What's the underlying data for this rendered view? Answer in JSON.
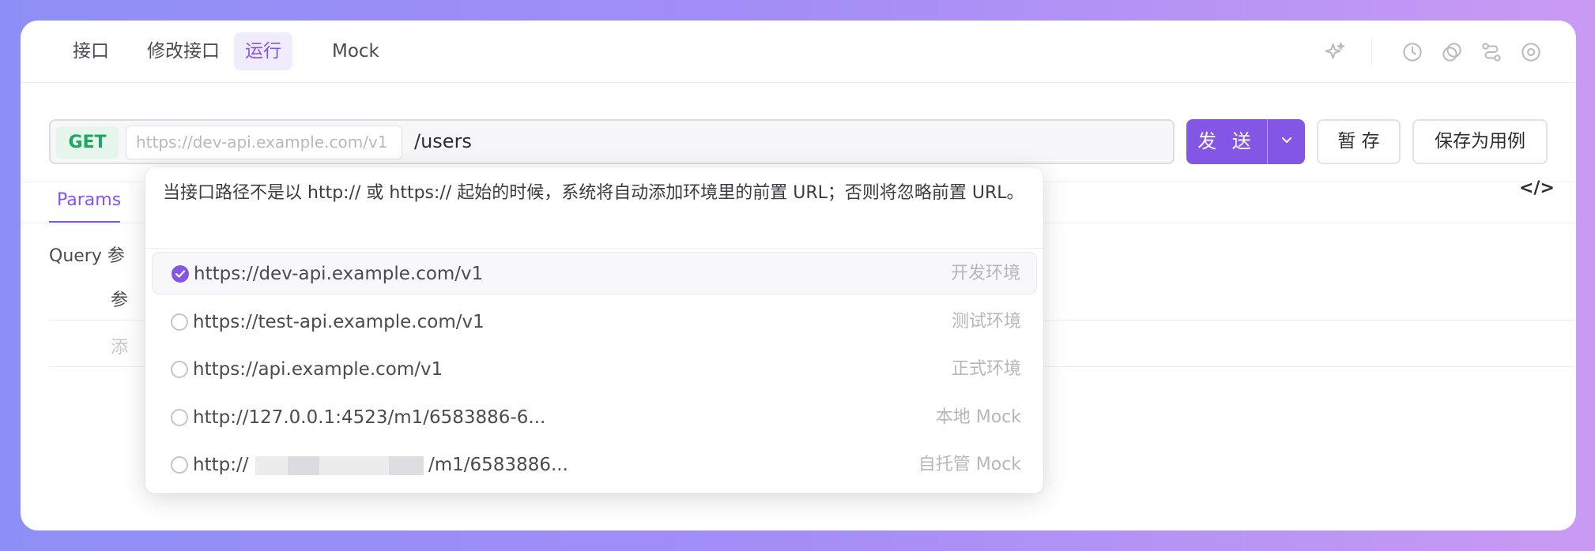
{
  "tabs": [
    {
      "label": "接口"
    },
    {
      "label": "修改接口"
    },
    {
      "label": "运行"
    },
    {
      "label": "Mock"
    }
  ],
  "toolbar_icons": [
    "sparkle-icon",
    "history-icon",
    "copy-icon",
    "share-icon",
    "settings-icon"
  ],
  "request": {
    "method": "GET",
    "base_url": "https://dev-api.example.com/v1",
    "path": "/users",
    "send_label": "发 送",
    "save_draft_label": "暂 存",
    "save_case_label": "保存为用例"
  },
  "params": {
    "tab_label": "Params",
    "query_label": "Query 参",
    "param_header": "参",
    "add_placeholder": "添"
  },
  "dropdown": {
    "description": "当接口路径不是以 http:// 或 https:// 起始的时候，系统将自动添加环境里的前置 URL；否则将忽略前置 URL。",
    "options": [
      {
        "url": "https://dev-api.example.com/v1",
        "env": "开发环境",
        "selected": true
      },
      {
        "url": "https://test-api.example.com/v1",
        "env": "测试环境",
        "selected": false
      },
      {
        "url": "https://api.example.com/v1",
        "env": "正式环境",
        "selected": false
      },
      {
        "url": "http://127.0.0.1:4523/m1/6583886-6...",
        "env": "本地 Mock",
        "selected": false
      },
      {
        "url_prefix": "http://",
        "url_suffix": "/m1/6583886...",
        "env": "自托管 Mock",
        "selected": false
      }
    ]
  },
  "colors": {
    "accent": "#8456e6",
    "method_get": "#1ea760"
  }
}
